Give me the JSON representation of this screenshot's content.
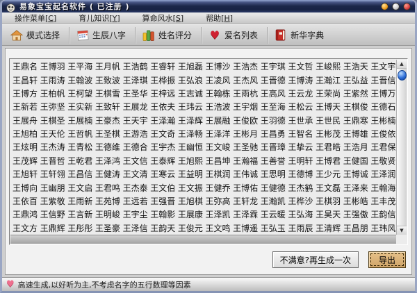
{
  "window": {
    "title": "易象宝宝起名软件 ( 已注册 )",
    "controls": [
      {
        "name": "minimize-button"
      },
      {
        "name": "restore-button"
      },
      {
        "name": "close-button"
      }
    ]
  },
  "menu": {
    "items": [
      {
        "id": "c",
        "pre": "操作菜单[",
        "key": "C",
        "post": "]"
      },
      {
        "id": "y",
        "pre": "育儿知识[",
        "key": "Y",
        "post": "]"
      },
      {
        "id": "s",
        "pre": "算命风水[",
        "key": "S",
        "post": "]"
      },
      {
        "id": "h",
        "pre": "帮助[",
        "key": "H",
        "post": "]"
      }
    ]
  },
  "toolbar": {
    "buttons": [
      {
        "id": "mode-select",
        "icon": "house-icon",
        "label": "模式选择"
      },
      {
        "id": "birth-bazi",
        "icon": "calendar-icon",
        "label": "生辰八字"
      },
      {
        "id": "name-score",
        "icon": "score-bars-icon",
        "label": "姓名评分"
      },
      {
        "id": "loved-names",
        "icon": "heart-icon",
        "label": "爱名列表"
      },
      {
        "id": "dictionary",
        "icon": "dictionary-icon",
        "label": "新华字典"
      }
    ]
  },
  "names_grid": {
    "columns": 14,
    "rows": [
      [
        "王鼎名",
        "王博羽",
        "王平海",
        "王月帆",
        "王浩鹤",
        "王睿轩",
        "王旭磊",
        "王博沙",
        "王浩杰",
        "王宇琪",
        "王文哲",
        "王峻熙",
        "王浩天",
        "王文宇"
      ],
      [
        "王昌轩",
        "王雨涛",
        "王翰波",
        "王致波",
        "王泽琪",
        "王桦振",
        "王弘浪",
        "王凌风",
        "王杰风",
        "王晋德",
        "王博涛",
        "王瀚江",
        "王弘益",
        "王晋信"
      ],
      [
        "王博方",
        "王柏帆",
        "王柯望",
        "王棋雪",
        "王圣华",
        "王梓远",
        "王志诚",
        "王翰栋",
        "王雨杭",
        "王高风",
        "王云龙",
        "王荣尚",
        "王紫然",
        "王博万"
      ],
      [
        "王新若",
        "王弥坚",
        "王实新",
        "王致轩",
        "王展龙",
        "王依夫",
        "王玮云",
        "王浩波",
        "王宇烟",
        "王至海",
        "王松云",
        "王博天",
        "王棋俊",
        "王德石"
      ],
      [
        "王展舟",
        "王棋圣",
        "王展楠",
        "王豪杰",
        "王天宇",
        "王泽瀚",
        "王泽辉",
        "王展融",
        "王俊欧",
        "王羽德",
        "王世承",
        "王世民",
        "王鼎寒",
        "王彬楠"
      ],
      [
        "王旭柏",
        "王天伦",
        "王哲帆",
        "王圣棋",
        "王游浩",
        "王文奇",
        "王泽畅",
        "王泽洋",
        "王彬月",
        "王昌勇",
        "王智名",
        "王彬茂",
        "王博雄",
        "王俊依"
      ],
      [
        "王炫明",
        "王杰涛",
        "王青松",
        "王德维",
        "王德合",
        "王宇杰",
        "王幽恒",
        "王文峻",
        "王圣驰",
        "王晋璋",
        "王挚云",
        "王君皓",
        "王浩月",
        "王君保"
      ],
      [
        "王茂辉",
        "王晋哲",
        "王乾君",
        "王泽鸿",
        "王文信",
        "王泰辉",
        "王旭熙",
        "王昌坤",
        "王瀚福",
        "王善誉",
        "王明轩",
        "王博君",
        "王健国",
        "王敬贤"
      ],
      [
        "王旭轩",
        "王轩翎",
        "王昌信",
        "王健涛",
        "王文清",
        "王寒云",
        "王益明",
        "王棋润",
        "王伟诚",
        "王思明",
        "王德博",
        "王少元",
        "王博诚",
        "王泽润"
      ],
      [
        "王博向",
        "王幽朋",
        "王文启",
        "王君鸣",
        "王杰泰",
        "王文伯",
        "王文振",
        "王健乔",
        "王博佑",
        "王健德",
        "王杰鹤",
        "王文磊",
        "王泽来",
        "王翰海"
      ],
      [
        "王依百",
        "王紫敬",
        "王雨新",
        "王苑博",
        "王远若",
        "王强晋",
        "王旭棋",
        "王弥高",
        "王轩龙",
        "王瀚凯",
        "王桦沙",
        "王棋羽",
        "王彬皓",
        "王丰茂"
      ],
      [
        "王鼎鸿",
        "王信野",
        "王言新",
        "王明峻",
        "王宇尘",
        "王翰影",
        "王展康",
        "王泽凯",
        "王泽霖",
        "王云暖",
        "王弘海",
        "王昊天",
        "王强傲",
        "王韵信"
      ],
      [
        "王文方",
        "王鼎辉",
        "王彤彤",
        "王圣豪",
        "王泽信",
        "王韵天",
        "王俊元",
        "王文鸣",
        "王博遥",
        "王弘玉",
        "王雨辰",
        "王清辉",
        "王昌朋",
        "王玮风"
      ]
    ]
  },
  "actions": {
    "regenerate_label": "不满意?再生成一次",
    "export_label": "导出"
  },
  "statusbar": {
    "icon": "heart-icon",
    "text": "高速生成,以好听为主,不考虑名字的五行数理等因素"
  },
  "scrollbar": {
    "up_arrow": "▲",
    "down_arrow": "▼"
  },
  "colors": {
    "titlebar": "#1c2849",
    "export_button": "#d9b178",
    "scroll_thumb": "#2f6fd8",
    "toolbar_heart": "#cf2030",
    "status_heart": "#ee6f8e"
  }
}
